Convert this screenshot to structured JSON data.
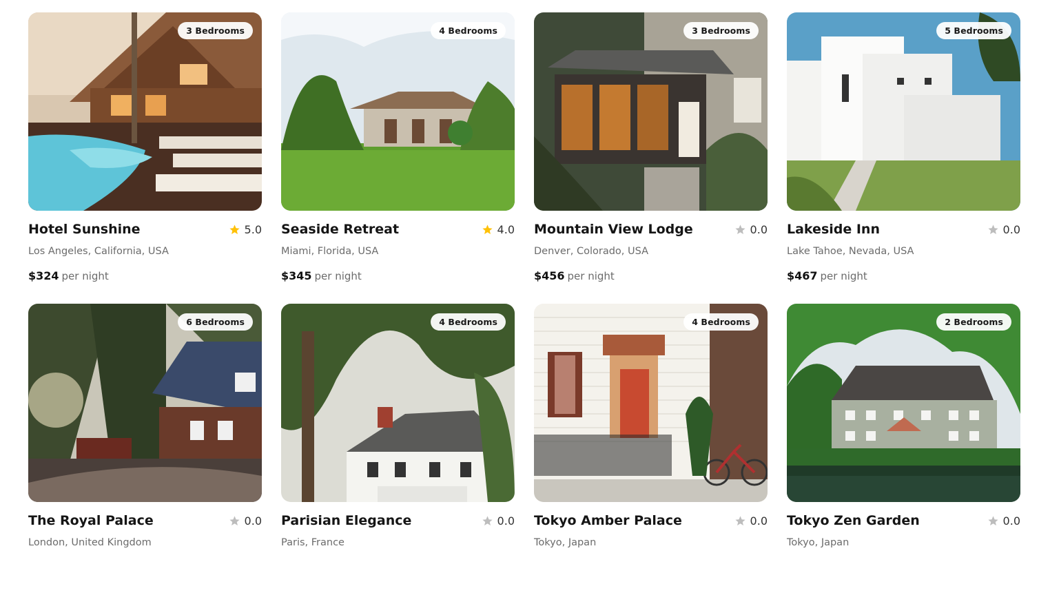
{
  "listings": [
    {
      "name": "Hotel Sunshine",
      "rating": "5.0",
      "rated": true,
      "location": "Los Angeles, California, USA",
      "price": "$324",
      "price_unit": "per night",
      "bedrooms": "3 Bedrooms",
      "image": "resort-pool"
    },
    {
      "name": "Seaside Retreat",
      "rating": "4.0",
      "rated": true,
      "location": "Miami, Florida, USA",
      "price": "$345",
      "price_unit": "per night",
      "bedrooms": "4 Bedrooms",
      "image": "villa-lawn"
    },
    {
      "name": "Mountain View Lodge",
      "rating": "0.0",
      "rated": false,
      "location": "Denver, Colorado, USA",
      "price": "$456",
      "price_unit": "per night",
      "bedrooms": "3 Bedrooms",
      "image": "porch-house"
    },
    {
      "name": "Lakeside Inn",
      "rating": "0.0",
      "rated": false,
      "location": "Lake Tahoe, Nevada, USA",
      "price": "$467",
      "price_unit": "per night",
      "bedrooms": "5 Bedrooms",
      "image": "white-modern"
    },
    {
      "name": "The Royal Palace",
      "rating": "0.0",
      "rated": false,
      "location": "London, United Kingdom",
      "price": "",
      "price_unit": "",
      "bedrooms": "6 Bedrooms",
      "image": "log-cabin"
    },
    {
      "name": "Parisian Elegance",
      "rating": "0.0",
      "rated": false,
      "location": "Paris, France",
      "price": "",
      "price_unit": "",
      "bedrooms": "4 Bedrooms",
      "image": "white-manor"
    },
    {
      "name": "Tokyo Amber Palace",
      "rating": "0.0",
      "rated": false,
      "location": "Tokyo, Japan",
      "price": "",
      "price_unit": "",
      "bedrooms": "4 Bedrooms",
      "image": "brick-townhouse"
    },
    {
      "name": "Tokyo Zen Garden",
      "rating": "0.0",
      "rated": false,
      "location": "Tokyo, Japan",
      "price": "",
      "price_unit": "",
      "bedrooms": "2 Bedrooms",
      "image": "stone-manor"
    }
  ],
  "colors": {
    "star_rated": "#FFC107",
    "star_unrated": "#BDBDBD"
  }
}
